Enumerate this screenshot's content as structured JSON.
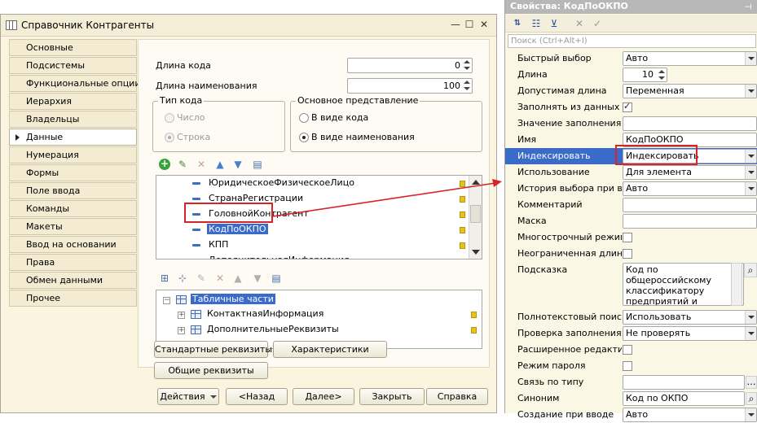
{
  "window": {
    "title": "Справочник Контрагенты",
    "controls": {
      "minimize": "—",
      "maximize": "☐",
      "close": "✕"
    }
  },
  "nav": {
    "items": [
      "Основные",
      "Подсистемы",
      "Функциональные опции",
      "Иерархия",
      "Владельцы",
      "Данные",
      "Нумерация",
      "Формы",
      "Поле ввода",
      "Команды",
      "Макеты",
      "Ввод на основании",
      "Права",
      "Обмен данными",
      "Прочее"
    ],
    "active_index": 5
  },
  "form": {
    "code_length_label": "Длина кода",
    "code_length_value": "0",
    "name_length_label": "Длина наименования",
    "name_length_value": "100",
    "code_type": {
      "title": "Тип кода",
      "option_number": "Число",
      "option_string": "Строка",
      "selected": "Строка"
    },
    "main_view": {
      "title": "Основное представление",
      "option_code": "В виде кода",
      "option_name": "В виде наименования",
      "selected": "В виде наименования"
    }
  },
  "attributes": {
    "items": [
      "ЮридическоеФизическоеЛицо",
      "СтранаРегистрации",
      "ГоловнойКонтрагент",
      "КодПоОКПО",
      "КПП",
      "ДополнительнаяИнформация"
    ],
    "selected": "КодПоОКПО"
  },
  "tables": {
    "root": "Табличные части",
    "items": [
      "КонтактнаяИнформация",
      "ДополнительныеРеквизиты"
    ]
  },
  "buttons": {
    "standard_attrs": "Стандартные реквизиты",
    "characteristics": "Характеристики",
    "common_attrs": "Общие реквизиты",
    "actions": "Действия",
    "back": "<Назад",
    "next": "Далее>",
    "close": "Закрыть",
    "help": "Справка"
  },
  "panel": {
    "title": "Свойства: КодПоОКПО",
    "pin": "⊣",
    "search_placeholder": "Поиск (Ctrl+Alt+I)",
    "hint_text": "Код по общероссийскому классификатору предприятий и",
    "rows": [
      {
        "label": "Быстрый выбор",
        "kind": "select",
        "value": "Авто"
      },
      {
        "label": "Длина",
        "kind": "spin",
        "value": "10"
      },
      {
        "label": "Допустимая длина",
        "kind": "select",
        "value": "Переменная"
      },
      {
        "label": "Заполнять из данных заполнения",
        "kind": "check",
        "checked": true
      },
      {
        "label": "Значение заполнения",
        "kind": "text",
        "value": ""
      },
      {
        "label": "Имя",
        "kind": "text",
        "value": "КодПоОКПО"
      },
      {
        "label": "Индексировать",
        "kind": "select",
        "value": "Индексировать"
      },
      {
        "label": "Использование",
        "kind": "select",
        "value": "Для элемента"
      },
      {
        "label": "История выбора при вводе",
        "kind": "select",
        "value": "Авто"
      },
      {
        "label": "Комментарий",
        "kind": "text",
        "value": ""
      },
      {
        "label": "Маска",
        "kind": "text",
        "value": ""
      },
      {
        "label": "Многострочный режим",
        "kind": "check",
        "checked": false
      },
      {
        "label": "Неограниченная длина",
        "kind": "check",
        "checked": false
      },
      {
        "label": "Подсказка",
        "kind": "hint"
      },
      {
        "label": "Полнотекстовый поиск",
        "kind": "select",
        "value": "Использовать"
      },
      {
        "label": "Проверка заполнения",
        "kind": "select",
        "value": "Не проверять"
      },
      {
        "label": "Расширенное редактирование",
        "kind": "check",
        "checked": false
      },
      {
        "label": "Режим пароля",
        "kind": "check",
        "checked": false
      },
      {
        "label": "Связь по типу",
        "kind": "text",
        "value": ""
      },
      {
        "label": "Синоним",
        "kind": "text",
        "value": "Код по ОКПО"
      },
      {
        "label": "Создание при вводе",
        "kind": "select",
        "value": "Авто"
      }
    ]
  },
  "colors": {
    "highlight": "#3a6bc8",
    "annotation": "#d8232a",
    "window_bg": "#fbf4df"
  }
}
